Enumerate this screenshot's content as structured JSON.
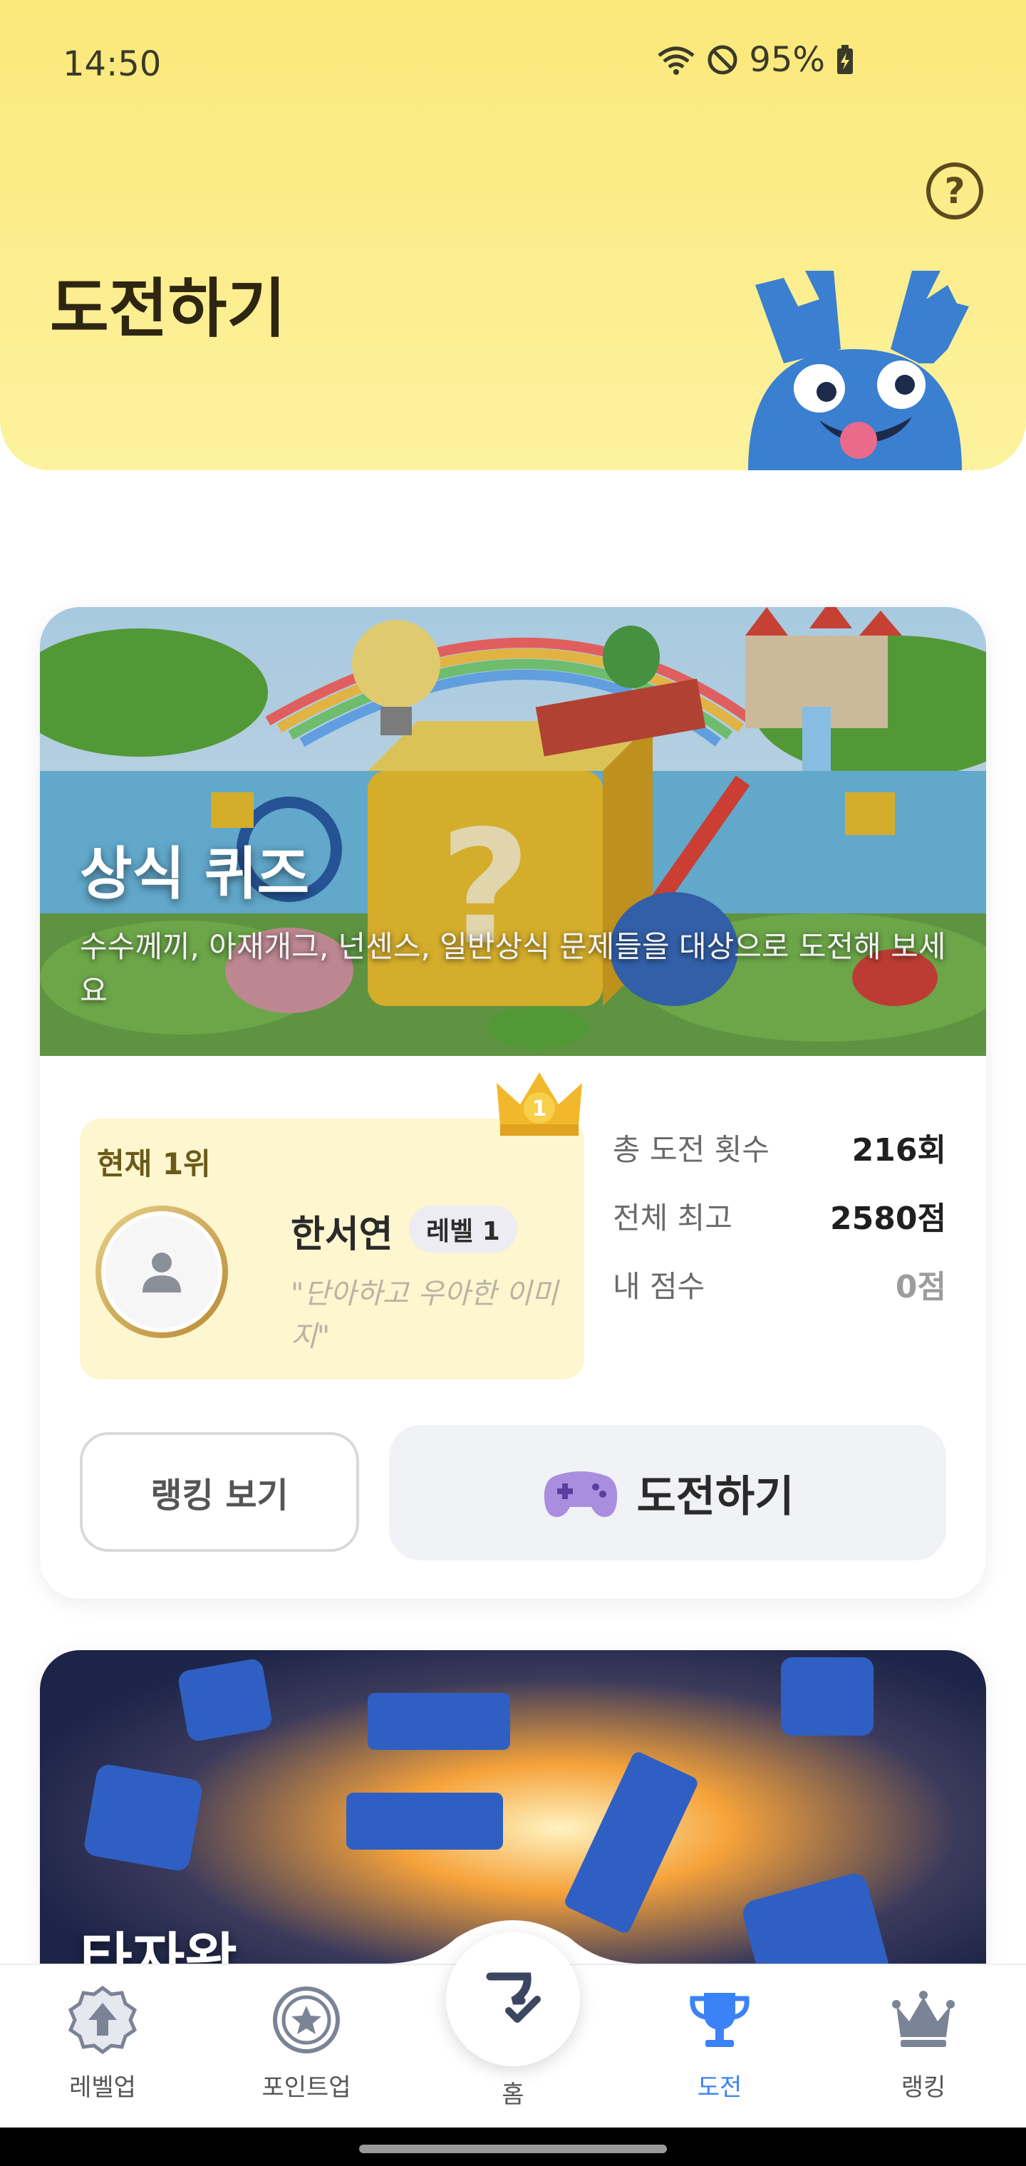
{
  "status_bar": {
    "time": "14:50",
    "battery": "95%"
  },
  "header": {
    "title": "도전하기",
    "help_icon": "question-circle-icon"
  },
  "quiz_card": {
    "banner_title": "상식 퀴즈",
    "banner_description": "수수께끼, 아재개그, 넌센스, 일반상식 문제들을 대상으로 도전해 보세요",
    "current_rank_label": "현재 1위",
    "crown_rank": "1",
    "user_name": "한서연",
    "user_level": "레벨 1",
    "user_quote": "\"단아하고 우아한 이미지\"",
    "stats": [
      {
        "label": "총 도전 횟수",
        "value": "216회"
      },
      {
        "label": "전체 최고",
        "value": "2580점"
      },
      {
        "label": "내 점수",
        "value": "0점"
      }
    ],
    "ranking_button": "랭킹 보기",
    "challenge_button": "도전하기"
  },
  "second_card": {
    "banner_title": "타자왕"
  },
  "bottom_nav": {
    "items": [
      {
        "label": "레벨업",
        "icon": "level-up-badge-icon"
      },
      {
        "label": "포인트업",
        "icon": "star-medal-icon"
      },
      {
        "label": "홈",
        "icon": "home-logo-icon"
      },
      {
        "label": "도전",
        "icon": "trophy-icon"
      },
      {
        "label": "랭킹",
        "icon": "crown-icon"
      }
    ],
    "active": "도전",
    "active_color": "#3b82f6"
  },
  "colors": {
    "header_bg": "#fbe87a",
    "accent": "#3b82f6"
  }
}
